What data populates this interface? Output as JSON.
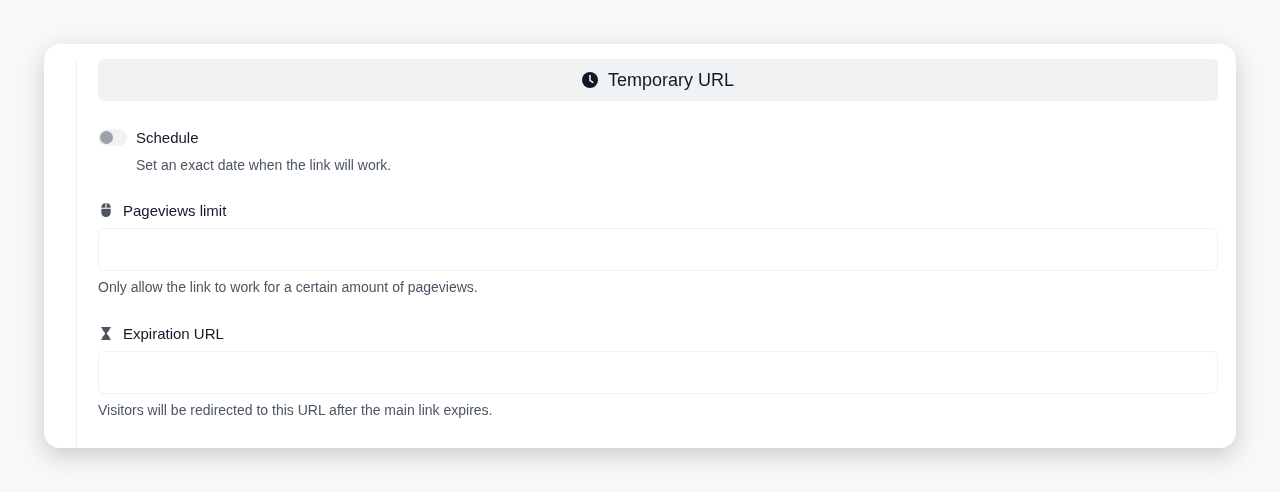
{
  "header": {
    "title": "Temporary URL"
  },
  "schedule": {
    "label": "Schedule",
    "description": "Set an exact date when the link will work.",
    "on": false
  },
  "fields": [
    {
      "kind": "mouse",
      "label": "Pageviews limit",
      "description": "Only allow the link to work for a certain amount of pageviews."
    },
    {
      "kind": "hourglass",
      "label": "Expiration URL",
      "description": "Visitors will be redirected to this URL after the main link expires."
    }
  ]
}
